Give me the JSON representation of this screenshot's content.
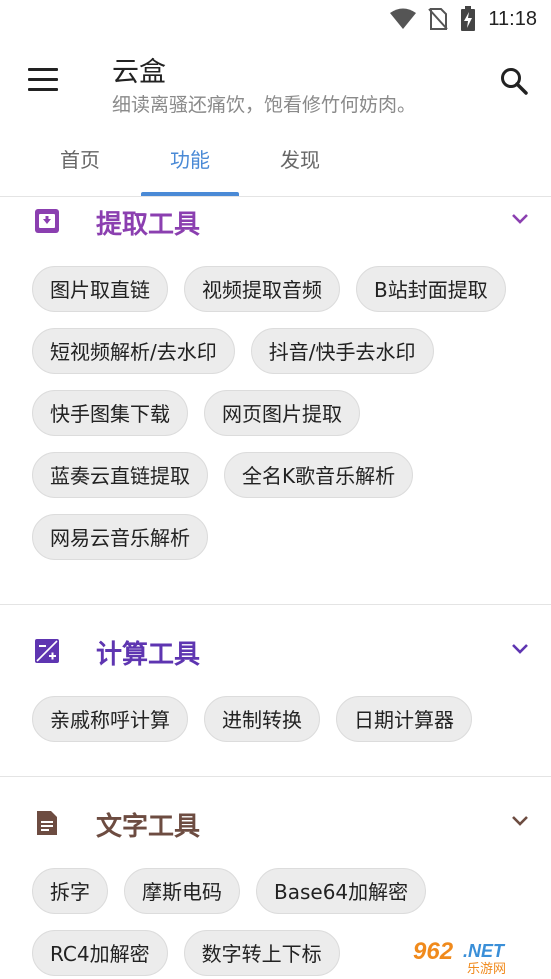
{
  "status": {
    "time": "11:18"
  },
  "appbar": {
    "title": "云盒",
    "subtitle": "细读离骚还痛饮，饱看修竹何妨肉。"
  },
  "tabs": [
    {
      "label": "首页"
    },
    {
      "label": "功能"
    },
    {
      "label": "发现"
    }
  ],
  "sections": [
    {
      "title": "提取工具",
      "color": "#8b3fb0",
      "icon": "download-box-icon",
      "chips": [
        "图片取直链",
        "视频提取音频",
        "B站封面提取",
        "短视频解析/去水印",
        "抖音/快手去水印",
        "快手图集下载",
        "网页图片提取",
        "蓝奏云直链提取",
        "全名K歌音乐解析",
        "网易云音乐解析"
      ]
    },
    {
      "title": "计算工具",
      "color": "#5e35b1",
      "icon": "calculator-icon",
      "chips": [
        "亲戚称呼计算",
        "进制转换",
        "日期计算器"
      ]
    },
    {
      "title": "文字工具",
      "color": "#6d4c41",
      "icon": "document-icon",
      "chips": [
        "拆字",
        "摩斯电码",
        "Base64加解密",
        "RC4加解密",
        "数字转上下标"
      ]
    }
  ],
  "watermark": {
    "text": "962.NET",
    "subtext": "乐游网"
  }
}
